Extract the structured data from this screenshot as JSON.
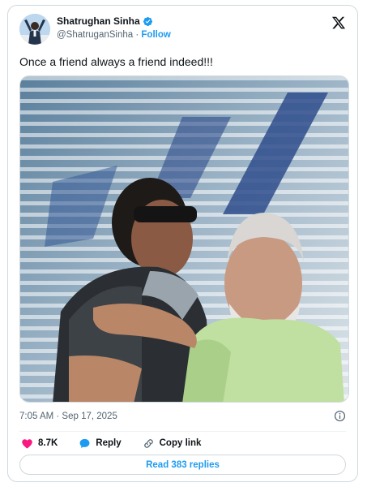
{
  "author": {
    "name": "Shatrughan Sinha",
    "handle": "@ShatruganSinha",
    "separator": " · ",
    "follow_label": "Follow",
    "verified_icon": "verified-badge-icon"
  },
  "brand_icon": "x-logo-icon",
  "tweet": {
    "text": "Once a friend always a friend indeed!!!",
    "timestamp": "7:05 AM · Sep 17, 2025"
  },
  "actions": {
    "likes_count": "8.7K",
    "reply_label": "Reply",
    "copy_link_label": "Copy link"
  },
  "read_replies_label": "Read 383 replies",
  "colors": {
    "accent": "#1d9bf0",
    "like": "#f91880",
    "text": "#0f1419",
    "muted": "#536471",
    "border": "#cfd9de"
  }
}
